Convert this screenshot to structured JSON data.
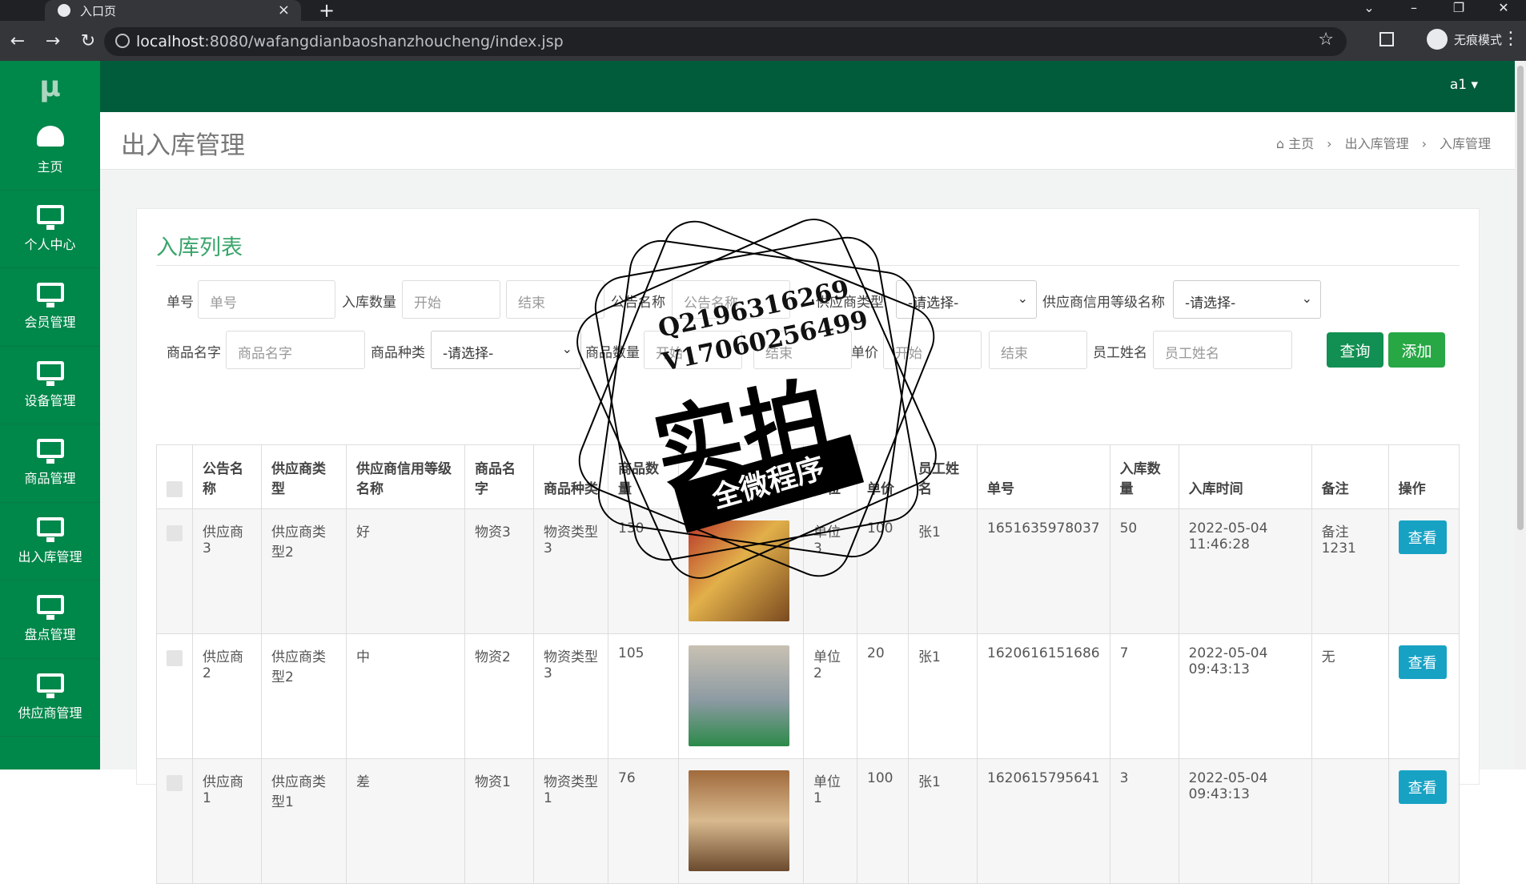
{
  "browser": {
    "tab_title": "入口页",
    "url_host": "localhost",
    "url_rest": ":8080/wafangdianbaoshanzhoucheng/index.jsp",
    "incognito_label": "无痕模式"
  },
  "app": {
    "logo": "μ",
    "user": "a1 ▾",
    "sidebar": [
      "主页",
      "个人中心",
      "会员管理",
      "设备管理",
      "商品管理",
      "出入库管理",
      "盘点管理",
      "供应商管理"
    ],
    "page_title": "出入库管理",
    "breadcrumb": [
      "主页",
      "出入库管理",
      "入库管理"
    ]
  },
  "card": {
    "title": "入库列表",
    "filters": {
      "danhao_label": "单号",
      "danhao_ph": "单号",
      "qty_label": "入库数量",
      "qty_start": "开始",
      "qty_end": "结束",
      "notice_label": "公告名称",
      "notice_ph": "公告名称",
      "suptype_label": "供应商类型",
      "suptype_val": "-请选择-",
      "credit_label": "供应商信用等级名称",
      "credit_val": "-请选择-",
      "goods_label": "商品名字",
      "goods_ph": "商品名字",
      "gtype_label": "商品种类",
      "gtype_val": "-请选择-",
      "gqty_label": "商品数量",
      "gqty_start": "开始",
      "gqty_end": "结束",
      "price_label": "单价",
      "price_start": "开始",
      "price_end": "结束",
      "staff_label": "员工姓名",
      "staff_ph": "员工姓名"
    },
    "query_btn": "查询",
    "add_btn": "添加",
    "columns": [
      "公告名称",
      "供应商类型",
      "供应商信用等级名称",
      "商品名字",
      "商品种类",
      "商品数量",
      "商品图片",
      "单位",
      "单价",
      "员工姓名",
      "单号",
      "入库数量",
      "入库时间",
      "备注",
      "操作"
    ],
    "rows": [
      {
        "notice": "供应商3",
        "suptype": "供应商类型2",
        "credit": "好",
        "goods": "物资3",
        "gtype": "物资类型3",
        "gqty": "130",
        "unit": "单位3",
        "price": "100",
        "staff": "张1",
        "no": "1651635978037",
        "qty": "50",
        "time": "2022-05-04 11:46:28",
        "note": "备注1231",
        "action": "查看"
      },
      {
        "notice": "供应商2",
        "suptype": "供应商类型2",
        "credit": "中",
        "goods": "物资2",
        "gtype": "物资类型3",
        "gqty": "105",
        "unit": "单位2",
        "price": "20",
        "staff": "张1",
        "no": "1620616151686",
        "qty": "7",
        "time": "2022-05-04 09:43:13",
        "note": "无",
        "action": "查看"
      },
      {
        "notice": "供应商1",
        "suptype": "供应商类型1",
        "credit": "差",
        "goods": "物资1",
        "gtype": "物资类型1",
        "gqty": "76",
        "unit": "单位1",
        "price": "100",
        "staff": "张1",
        "no": "1620615795641",
        "qty": "3",
        "time": "2022-05-04 09:43:13",
        "note": "",
        "action": "查看"
      }
    ]
  },
  "stamp": {
    "line1": "Q2196316269",
    "line2": "V17060256499",
    "big": "实拍",
    "band": "全微程序"
  },
  "colors": {
    "sidebar": "#00874a",
    "header": "#005c3a",
    "query": "#128f52",
    "add": "#28a745",
    "view": "#17a2c4"
  }
}
